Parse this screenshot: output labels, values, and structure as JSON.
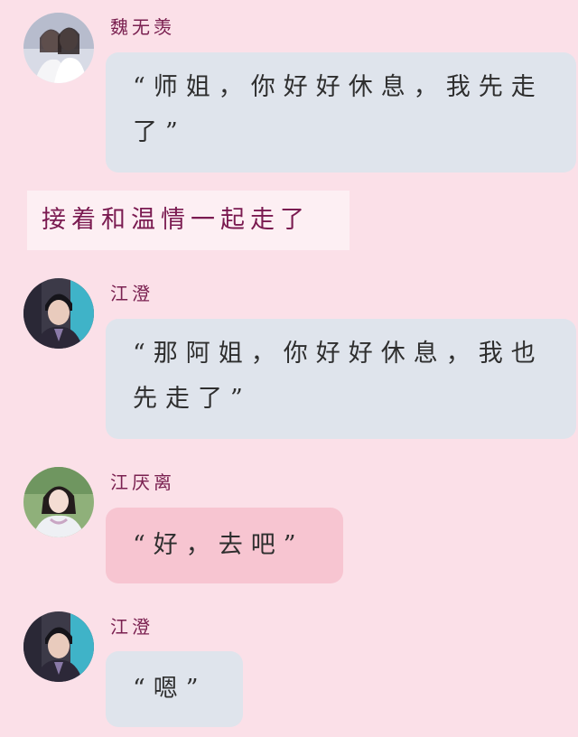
{
  "messages": [
    {
      "sender": "魏无羡",
      "text": "“师姐，你好好休息，我先走了”",
      "avatar_icon": "couple-portrait-avatar"
    },
    {
      "sender": "江澄",
      "text": "“那阿姐，你好好休息，我也先走了”",
      "avatar_icon": "man-portrait-avatar"
    },
    {
      "sender": "江厌离",
      "text": "“好，去吧”",
      "avatar_icon": "woman-portrait-avatar"
    },
    {
      "sender": "江澄",
      "text": "“嗯”",
      "avatar_icon": "man-portrait-avatar"
    }
  ],
  "narration": "接着和温情一起走了",
  "colors": {
    "background": "#fbe0e8",
    "name": "#7a2050",
    "blue_bubble": "#dfe4ec",
    "pink_bubble": "#f7c5d1",
    "narration_text": "#7a1a50"
  }
}
